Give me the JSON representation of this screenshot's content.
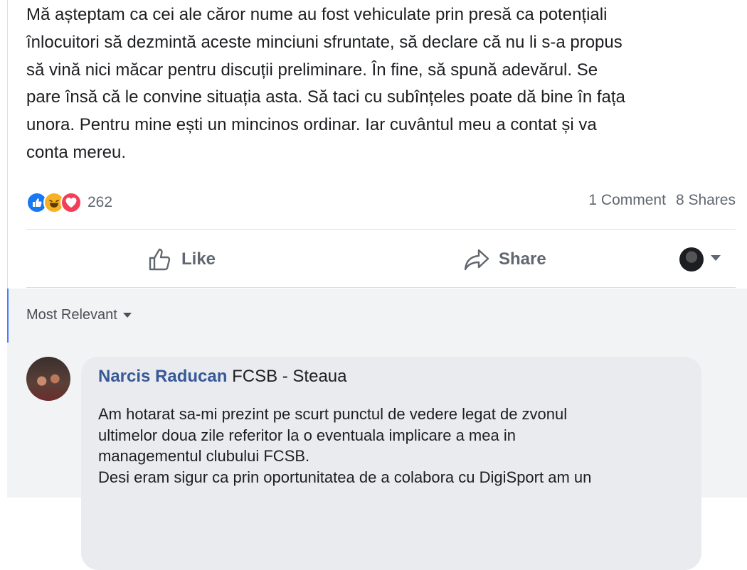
{
  "post": {
    "lines": [
      "Mă așteptam ca cei ale căror nume au fost vehiculate prin presă ca potențiali",
      "înlocuitori să dezmintă aceste minciuni sfruntate, să declare că nu li s-a propus",
      "să vină nici măcar pentru discuții preliminare. În fine, să spună adevărul. Se",
      "pare însă că le convine situația asta. Să taci cu subînțeles poate dă bine în fața",
      "unora. Pentru mine ești un mincinos ordinar. Iar cuvântul meu a contat și va",
      "conta mereu."
    ],
    "reaction_count": "262",
    "comments_label": "1 Comment",
    "shares_label": "8 Shares",
    "reaction_icons": [
      "like-reaction-icon",
      "haha-reaction-icon",
      "love-reaction-icon"
    ]
  },
  "actions": {
    "like_label": "Like",
    "share_label": "Share"
  },
  "comments": {
    "sort_label": "Most Relevant",
    "items": [
      {
        "author": "Narcis Raducan",
        "group": "FCSB - Steaua",
        "lines": [
          "Am hotarat sa-mi prezint pe scurt punctul de vedere legat de zvonul",
          "ultimelor doua zile referitor la o eventuala implicare a mea in",
          "managementul clubului FCSB.",
          "Desi eram sigur ca prin oportunitatea de a colabora cu DigiSport am un"
        ]
      }
    ]
  },
  "colors": {
    "link": "#385898",
    "muted": "#606770",
    "like_blue": "#1877f2",
    "haha_yellow": "#f7b125",
    "love_red": "#f33e58",
    "comment_bg": "#f2f3f5",
    "bubble_bg": "#e9ebee"
  }
}
